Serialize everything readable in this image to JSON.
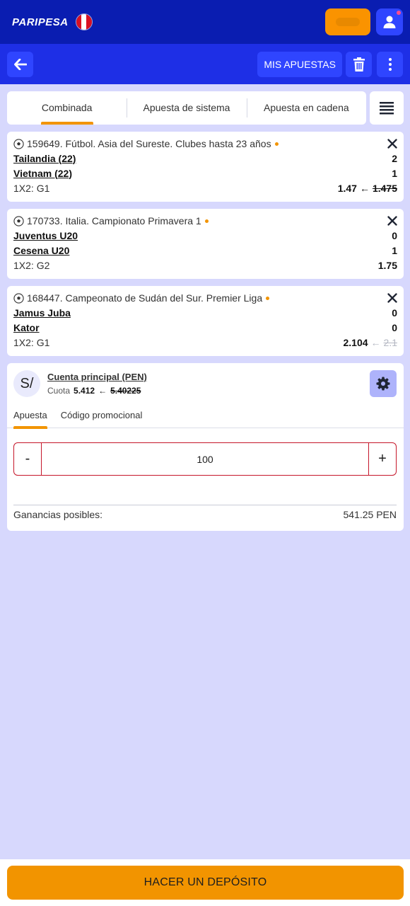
{
  "header": {
    "logo_text": "PARIPESA",
    "flag": "peru-flag",
    "balance_hidden": true
  },
  "subbar": {
    "my_bets_label": "MIS APUESTAS"
  },
  "bet_types": {
    "tabs": [
      "Combinada",
      "Apuesta de sistema",
      "Apuesta en cadena"
    ],
    "active": "Combinada"
  },
  "bets": [
    {
      "event": "159649. Fútbol. Asia del Sureste. Clubes hasta 23 años",
      "team1": "Tailandia (22)",
      "score1": "2",
      "team2": "Vietnam (22)",
      "score2": "1",
      "market": "1X2: G1",
      "odds": "1.47",
      "old_odds": "1.475"
    },
    {
      "event": "170733. Italia. Campionato Primavera 1",
      "team1": "Juventus U20",
      "score1": "0",
      "team2": "Cesena U20",
      "score2": "1",
      "market": "1X2: G2",
      "odds": "1.75"
    },
    {
      "event": "168447. Campeonato de Sudán del Sur. Premier Liga",
      "team1": "Jamus Juba",
      "score1": "0",
      "team2": "Kator",
      "score2": "0",
      "market": "1X2: G1",
      "odds": "2.104",
      "old_odds": "2.1"
    }
  ],
  "coupon": {
    "currency_symbol": "S/",
    "account_name": "Cuenta principal (PEN)",
    "cuota_label": "Cuota",
    "cuota_value": "5.412",
    "cuota_old": "5.40225",
    "tabs": [
      "Apuesta",
      "Código promocional"
    ],
    "active_tab": "Apuesta",
    "stake": "100",
    "minus_label": "-",
    "plus_label": "+",
    "winnings_label": "Ganancias posibles:",
    "winnings_value": "541.25 PEN"
  },
  "footer": {
    "deposit_label": "HACER UN DEPÓSITO"
  },
  "colors": {
    "topbar": "#0a1db1",
    "subbar": "#1e2fe6",
    "accent": "#f29400",
    "background": "#d7d8fd"
  }
}
